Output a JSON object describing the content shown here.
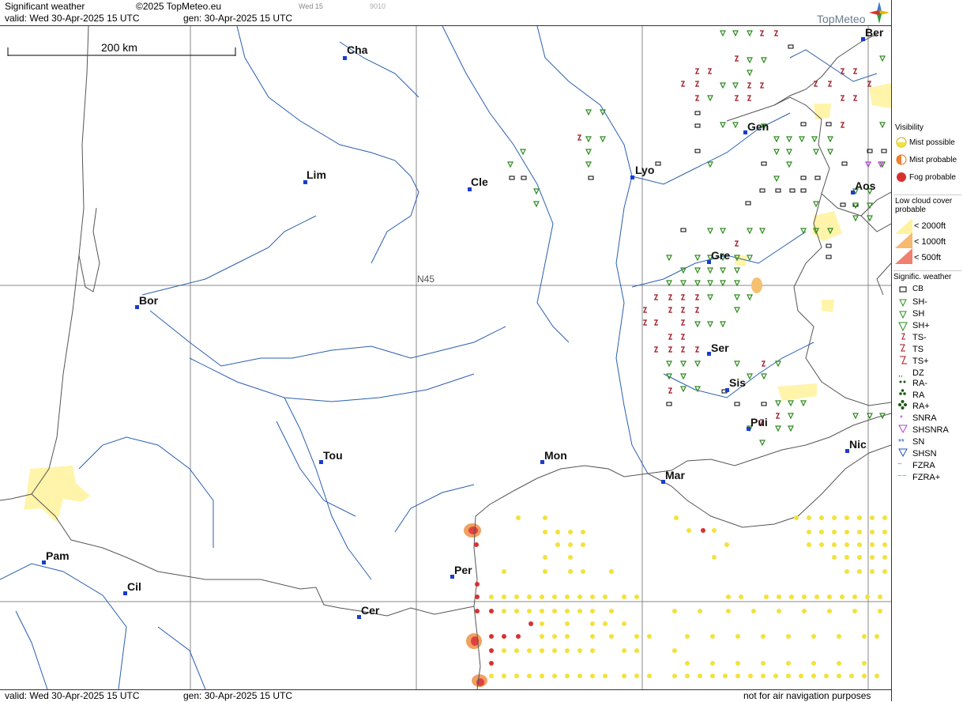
{
  "header": {
    "product": "Significant weather",
    "copyright": "©2025 TopMeteo.eu",
    "day_hour": "Wed 15",
    "code": "9010",
    "valid": "valid:  Wed  30-Apr-2025  15 UTC",
    "generated": "gen:  30-Apr-2025  15 UTC",
    "logo_text": "TopMeteo"
  },
  "footer": {
    "valid": "valid:  Wed  30-Apr-2025  15 UTC",
    "generated": "gen:  30-Apr-2025  15 UTC",
    "disclaimer": "not for air navigation purposes"
  },
  "map": {
    "scale_label": "200 km",
    "latitude_label": "N45",
    "cities": [
      "Cha",
      "Lim",
      "Cle",
      "Lyo",
      "Ber",
      "Gen",
      "Aos",
      "Gre",
      "Bor",
      "Ser",
      "Sis",
      "Pui",
      "Tou",
      "Mon",
      "Mar",
      "Nic",
      "Pam",
      "Cil",
      "Per",
      "Cer"
    ]
  },
  "legend": {
    "visibility_title": "Visibility",
    "mist_possible": "Mist possible",
    "mist_probable": "Mist probable",
    "fog_probable": "Fog probable",
    "low_cloud_title": "Low cloud cover probable",
    "lc_2000": "< 2000ft",
    "lc_1000": "< 1000ft",
    "lc_500": "<   500ft",
    "sigwx_title": "Signific. weather",
    "items": [
      "CB",
      "SH-",
      "SH",
      "SH+",
      "TS-",
      "TS",
      "TS+",
      "DZ",
      "RA-",
      "RA",
      "RA+",
      "SNRA",
      "SHSNRA",
      "SN",
      "SHSN",
      "FZRA",
      "FZRA+"
    ]
  },
  "colors": {
    "rivers": "#2a5fb0",
    "borders": "#555555",
    "grid": "#888888",
    "showers": "#2e8b1e",
    "thunder": "#a0141e",
    "mist": "#f2e23a",
    "fog": "#e04040",
    "low_cloud": "#fff3a0"
  }
}
